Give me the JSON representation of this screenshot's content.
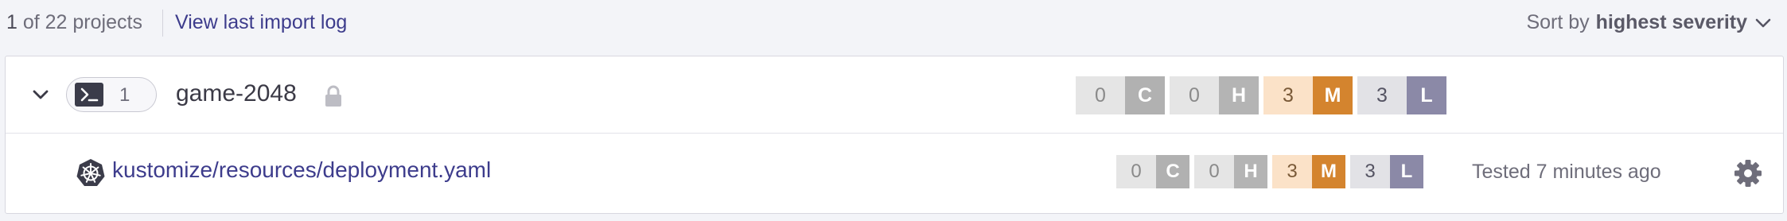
{
  "header": {
    "count_num": "1",
    "count_text": " of 22 projects",
    "import_log_link": "View last import log",
    "sort_label": "Sort by ",
    "sort_value": "highest severity"
  },
  "project": {
    "name": "game-2048",
    "target_count": "1",
    "icon": "terminal-icon",
    "severity": {
      "critical": "0",
      "high": "0",
      "medium": "3",
      "low": "3"
    }
  },
  "target": {
    "path": "kustomize/resources/deployment.yaml",
    "icon": "kubernetes-icon",
    "severity": {
      "critical": "0",
      "high": "0",
      "medium": "3",
      "low": "3"
    },
    "tested": "Tested 7 minutes ago"
  },
  "severity_letters": {
    "critical": "C",
    "high": "H",
    "medium": "M",
    "low": "L"
  },
  "colors": {
    "link": "#3d3c8c",
    "medium": "#d4842e",
    "low": "#8b89a7",
    "critical_high": "#b1b1b1"
  }
}
